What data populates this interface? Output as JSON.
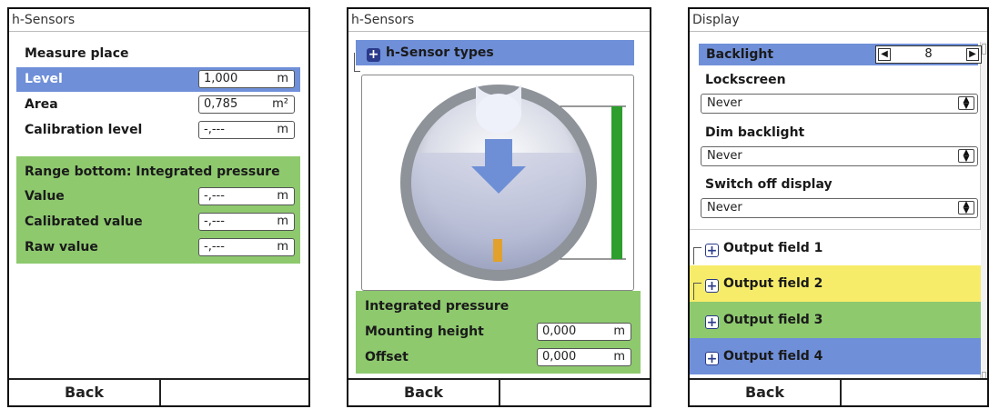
{
  "screen1": {
    "title": "h-Sensors",
    "section_title": "Measure place",
    "rows": [
      {
        "label": "Level",
        "value": "1,000",
        "unit": "m",
        "selected": true
      },
      {
        "label": "Area",
        "value": "0,785",
        "unit": "m²"
      },
      {
        "label": "Calibration level",
        "value": "-,---",
        "unit": "m"
      }
    ],
    "range_title": "Range bottom: Integrated pressure",
    "range_rows": [
      {
        "label": "Value",
        "value": "-,---",
        "unit": "m"
      },
      {
        "label": "Calibrated value",
        "value": "-,---",
        "unit": "m"
      },
      {
        "label": "Raw value",
        "value": "-,---",
        "unit": "m"
      }
    ],
    "footer_left": "Back",
    "footer_right": ""
  },
  "screen2": {
    "title": "h-Sensors",
    "group_label": "h-Sensor types",
    "section_title": "Integrated pressure",
    "rows": [
      {
        "label": "Mounting height",
        "value": "0,000",
        "unit": "m"
      },
      {
        "label": "Offset",
        "value": "0,000",
        "unit": "m"
      }
    ],
    "footer_left": "Back",
    "footer_right": ""
  },
  "screen3": {
    "title": "Display",
    "backlight_label": "Backlight",
    "backlight_value": "8",
    "lockscreen_label": "Lockscreen",
    "lockscreen_value": "Never",
    "dim_label": "Dim backlight",
    "dim_value": "Never",
    "switch_label": "Switch off display",
    "switch_value": "Never",
    "output_fields": [
      {
        "label": "Output field 1",
        "color": "#ffffff"
      },
      {
        "label": "Output field 2",
        "color": "#f7ec6a"
      },
      {
        "label": "Output field 3",
        "color": "#8ec96e"
      },
      {
        "label": "Output field 4",
        "color": "#6f8fd8"
      }
    ],
    "footer_left": "Back",
    "footer_right": ""
  },
  "colors": {
    "selection_blue": "#6f8fd8",
    "group_green": "#8ec96e",
    "highlight_yellow": "#f7ec6a",
    "header_blue": "#2a3a8a"
  }
}
